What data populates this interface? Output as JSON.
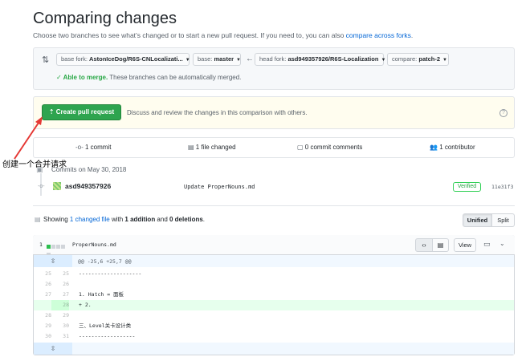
{
  "header": {
    "title": "Comparing changes",
    "subtitle_prefix": "Choose two branches to see what’s changed or to start a new pull request. If you need to, you can also ",
    "subtitle_link": "compare across forks",
    "subtitle_suffix": "."
  },
  "range": {
    "base_fork_key": "base fork: ",
    "base_fork_value": "AstonIceDog/R6S-CNLocalizati...",
    "base_key": "base: ",
    "base_value": "master",
    "head_fork_key": "head fork: ",
    "head_fork_value": "asd949357926/R6S-Localization",
    "compare_key": "compare: ",
    "compare_value": "patch-2",
    "merge_ok": "Able to merge.",
    "merge_msg": " These branches can be automatically merged."
  },
  "pr": {
    "button_label": "Create pull request",
    "description": "Discuss and review the changes in this comparison with others.",
    "help": "?"
  },
  "annotation": {
    "text": "创建一个合并请求"
  },
  "stats": {
    "commits": "1 commit",
    "files": "1 file changed",
    "comments": "0 commit comments",
    "contributors": "1 contributor"
  },
  "commits": {
    "header": "Commits on May 30, 2018",
    "items": [
      {
        "author": "asd949357926",
        "message": "Update ProperNouns.md",
        "verified": "Verified",
        "sha": "11e31f3"
      }
    ]
  },
  "summary": {
    "prefix": "Showing ",
    "changed": "1 changed file",
    "mid": " with ",
    "additions": "1 addition",
    "and": " and ",
    "deletions": "0 deletions",
    "end": ".",
    "unified": "Unified",
    "split": "Split"
  },
  "file": {
    "count": "1",
    "name": "ProperNouns.md",
    "view_label": "View",
    "hunk": "@@ -25,6 +25,7 @@",
    "lines": [
      {
        "old": "25",
        "new": "25",
        "text": "--------------------",
        "type": "ctx"
      },
      {
        "old": "26",
        "new": "26",
        "text": "",
        "type": "ctx"
      },
      {
        "old": "27",
        "new": "27",
        "text": "1. Hatch = 面板",
        "type": "ctx"
      },
      {
        "old": "",
        "new": "28",
        "text": "+ 2.",
        "type": "add"
      },
      {
        "old": "28",
        "new": "29",
        "text": "",
        "type": "ctx"
      },
      {
        "old": "29",
        "new": "30",
        "text": "三、Level关卡设计类",
        "type": "ctx"
      },
      {
        "old": "30",
        "new": "31",
        "text": "------------------",
        "type": "ctx"
      }
    ]
  },
  "colors": {
    "accent": "#0366d6",
    "create_button": "#2ea44f",
    "addition_bg": "#e6ffed",
    "hunk_bg": "#f1f8ff"
  }
}
